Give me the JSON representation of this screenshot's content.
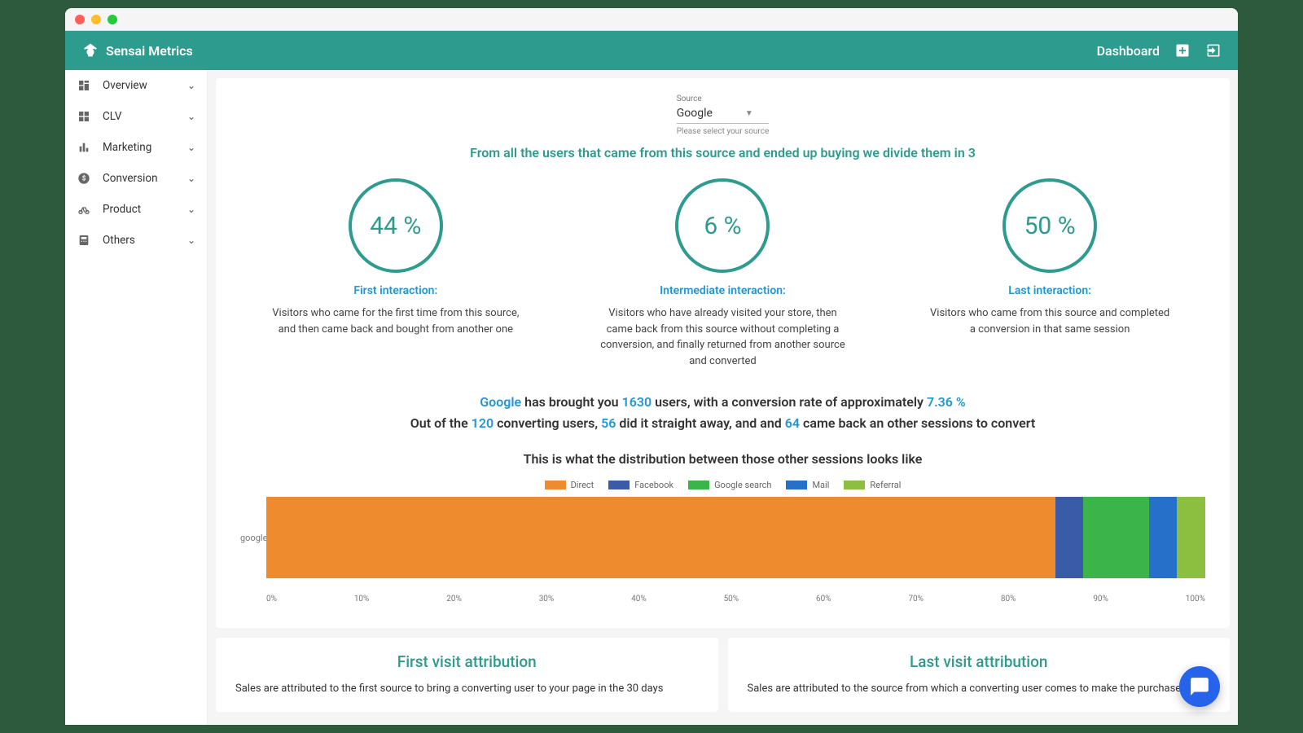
{
  "brand": "Sensai Metrics",
  "header": {
    "dashboard": "Dashboard"
  },
  "sidebar": {
    "items": [
      {
        "label": "Overview",
        "icon": "dashboard"
      },
      {
        "label": "CLV",
        "icon": "grid"
      },
      {
        "label": "Marketing",
        "icon": "bar"
      },
      {
        "label": "Conversion",
        "icon": "dollar"
      },
      {
        "label": "Product",
        "icon": "bike"
      },
      {
        "label": "Others",
        "icon": "calc"
      }
    ]
  },
  "source": {
    "label": "Source",
    "value": "Google",
    "hint": "Please select your source"
  },
  "tagline": "From all the users that came from this source and ended up buying we divide them in 3",
  "circles": [
    {
      "pct": "44 %",
      "title": "First interaction:",
      "desc": "Visitors who came for the first time from this source, and then came back and bought from another one"
    },
    {
      "pct": "6 %",
      "title": "Intermediate interaction:",
      "desc": "Visitors who have already visited your store, then came back from this source without completing a conversion, and finally returned from another source and converted"
    },
    {
      "pct": "50 %",
      "title": "Last interaction:",
      "desc": "Visitors who came from this source and completed a conversion in that same session"
    }
  ],
  "summary": {
    "p1a": "Google",
    "p1b": " has brought you ",
    "p1c": "1630",
    "p1d": " users, with a conversion rate of approximately ",
    "p1e": "7.36 %",
    "p2a": "Out of the ",
    "p2b": "120",
    "p2c": " converting users, ",
    "p2d": "56",
    "p2e": " did it straight away, and and ",
    "p2f": "64",
    "p2g": " came back an other sessions to convert"
  },
  "dist_title": "This is what the distribution between those other sessions looks like",
  "chart_data": {
    "type": "bar",
    "orientation": "stacked-horizontal",
    "categories": [
      "google"
    ],
    "series": [
      {
        "name": "Direct",
        "color": "#ee8b2e",
        "values": [
          84
        ]
      },
      {
        "name": "Facebook",
        "color": "#3a5ca8",
        "values": [
          3
        ]
      },
      {
        "name": "Google search",
        "color": "#3bb54a",
        "values": [
          7
        ]
      },
      {
        "name": "Mail",
        "color": "#2770c9",
        "values": [
          3
        ]
      },
      {
        "name": "Referral",
        "color": "#8cbf3f",
        "values": [
          3
        ]
      }
    ],
    "xlim": [
      0,
      100
    ],
    "xticks": [
      "0%",
      "10%",
      "20%",
      "30%",
      "40%",
      "50%",
      "60%",
      "70%",
      "80%",
      "90%",
      "100%"
    ]
  },
  "attrib": [
    {
      "title": "First visit attribution",
      "text": "Sales are attributed to the first source to bring a converting user to your page in the 30 days"
    },
    {
      "title": "Last visit attribution",
      "text": "Sales are attributed to the source from which a converting user comes to make the purchase,"
    }
  ]
}
